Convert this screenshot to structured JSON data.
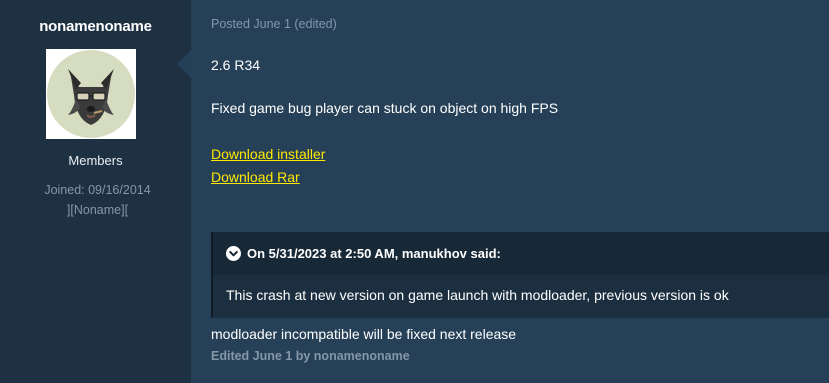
{
  "author": {
    "name": "nonamenoname",
    "group": "Members",
    "joined": "Joined: 09/16/2014",
    "custom_title": "][Noname]["
  },
  "post": {
    "date": "Posted June 1 (edited)",
    "version": "2.6 R34",
    "changelog": "Fixed game bug player can stuck on object on high FPS",
    "links": [
      {
        "label": "Download installer"
      },
      {
        "label": "Download Rar"
      }
    ],
    "quote": {
      "citation": "On 5/31/2023 at 2:50 AM, manukhov said:",
      "text": "This crash at new version on game launch with modloader, previous version is ok"
    },
    "reply": "modloader incompatible will be fixed next release",
    "edited": "Edited June 1 by nonamenoname"
  },
  "colors": {
    "link": "#ffe800",
    "muted": "#8497a9",
    "post_bg": "#264057",
    "author_bg": "#1d3142"
  },
  "icons": {
    "quote_toggle": "chevron-down-circle-icon",
    "avatar": "wolf-with-sunglasses-avatar"
  }
}
